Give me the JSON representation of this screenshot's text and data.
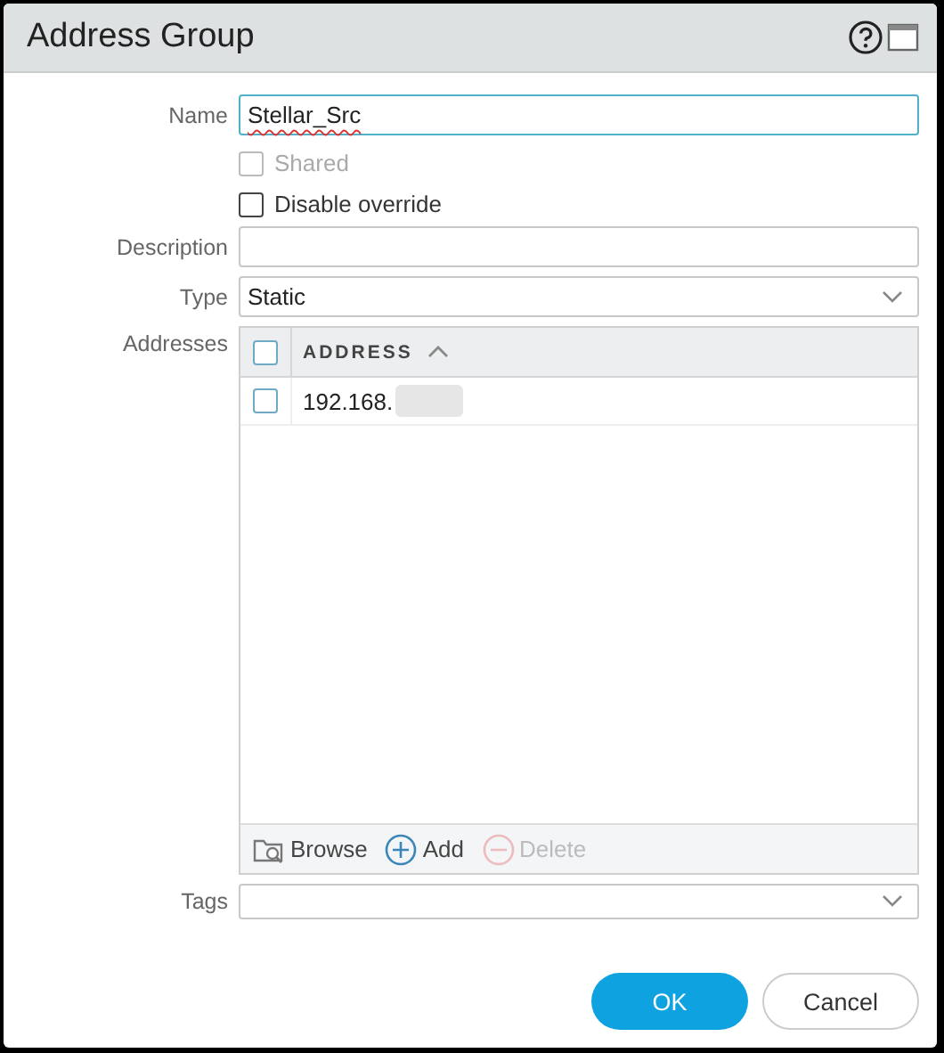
{
  "window": {
    "title": "Address Group"
  },
  "name_field": {
    "label": "Name",
    "value": "Stellar_Src",
    "focused": true
  },
  "options": [
    {
      "label": "Shared",
      "checked": false,
      "disabled": true
    },
    {
      "label": "Disable override",
      "checked": false,
      "disabled": false
    }
  ],
  "description_field": {
    "label": "Description"
  },
  "type_field": {
    "label": "Type",
    "value": "Static"
  },
  "addresses": {
    "label": "Addresses",
    "select_all": {
      "checked": false
    },
    "columns": [
      {
        "label": "ADDRESS",
        "sorted_ascending": true
      }
    ],
    "rows": [
      {
        "address": "192.168.",
        "checked": false,
        "redacted": true
      }
    ],
    "actions": [
      {
        "kind": "browse",
        "label": "Browse",
        "disabled": false
      },
      {
        "kind": "add",
        "label": "Add",
        "disabled": false
      },
      {
        "kind": "delete",
        "label": "Delete",
        "disabled": true
      }
    ]
  },
  "tags_field": {
    "label": "Tags"
  },
  "buttons": [
    {
      "kind": "primary",
      "label": "OK"
    },
    {
      "kind": "secondary",
      "label": "Cancel"
    }
  ]
}
